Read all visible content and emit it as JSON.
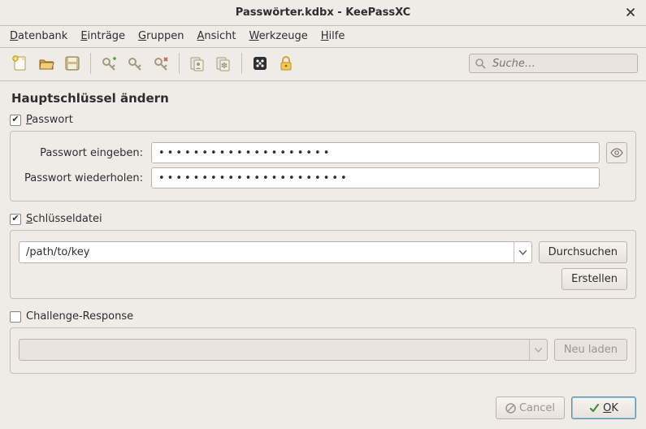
{
  "window": {
    "title": "Passwörter.kdbx - KeePassXC"
  },
  "menu": {
    "database": "Datenbank",
    "entries": "Einträge",
    "groups": "Gruppen",
    "view": "Ansicht",
    "tools": "Werkzeuge",
    "help": "Hilfe"
  },
  "search": {
    "placeholder": "Suche…"
  },
  "page": {
    "heading": "Hauptschlüssel ändern",
    "password_section": {
      "checkbox_label": "Passwort",
      "enter_label": "Passwort eingeben:",
      "repeat_label": "Passwort wiederholen:",
      "enter_value": "••••••••••••••••••••",
      "repeat_value": "••••••••••••••••••••••"
    },
    "keyfile_section": {
      "checkbox_label": "Schlüsseldatei",
      "path": "/path/to/key",
      "browse": "Durchsuchen",
      "create": "Erstellen"
    },
    "challenge_section": {
      "checkbox_label": "Challenge-Response",
      "reload": "Neu laden"
    }
  },
  "footer": {
    "cancel": "Cancel",
    "ok": "OK"
  }
}
